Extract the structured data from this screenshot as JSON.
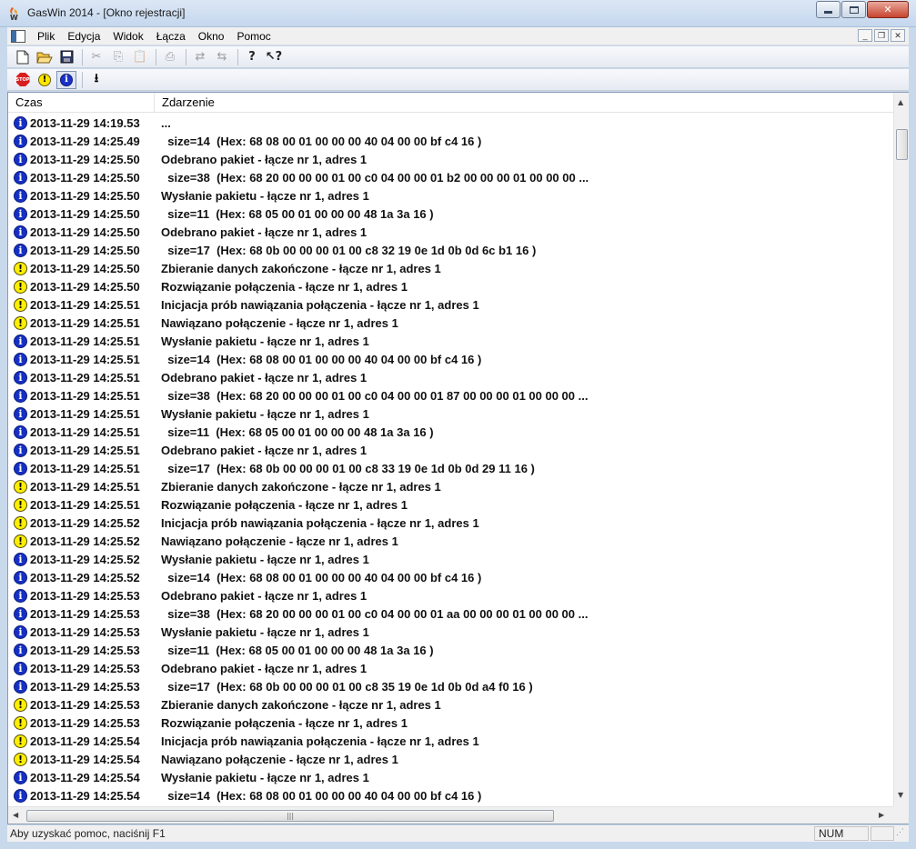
{
  "window": {
    "title": "GasWin 2014 - [Okno rejestracji]",
    "minimize": "0",
    "maximize": "1",
    "close": "r"
  },
  "menu": [
    {
      "label": "Plik"
    },
    {
      "label": "Edycja"
    },
    {
      "label": "Widok"
    },
    {
      "label": "Łącza"
    },
    {
      "label": "Okno"
    },
    {
      "label": "Pomoc"
    }
  ],
  "toolbar1": [
    "new-file-icon",
    "open-folder-icon",
    "save-icon",
    "cut-icon",
    "copy-icon",
    "paste-icon",
    "print-icon",
    "connect-icon",
    "disconnect-icon",
    "help-icon",
    "context-help-icon"
  ],
  "toolbar2": [
    "stop-icon",
    "warning-filter-icon",
    "info-filter-icon",
    "download-icon"
  ],
  "columns": {
    "time": "Czas",
    "event": "Zdarzenie"
  },
  "colors": {
    "info": "#1530c4",
    "warning": "#ffee00"
  },
  "log": [
    {
      "type": "info",
      "time": "2013-11-29 14:19.53",
      "event": "..."
    },
    {
      "type": "info",
      "time": "2013-11-29 14:25.49",
      "event": "  size=14  (Hex: 68 08 00 01 00 00 00 40 04 00 00 bf c4 16 )"
    },
    {
      "type": "info",
      "time": "2013-11-29 14:25.50",
      "event": "Odebrano pakiet - łącze nr 1, adres 1"
    },
    {
      "type": "info",
      "time": "2013-11-29 14:25.50",
      "event": "  size=38  (Hex: 68 20 00 00 00 01 00 c0 04 00 00 01 b2 00 00 00 01 00 00 00 ..."
    },
    {
      "type": "info",
      "time": "2013-11-29 14:25.50",
      "event": "Wysłanie pakietu - łącze nr 1, adres 1"
    },
    {
      "type": "info",
      "time": "2013-11-29 14:25.50",
      "event": "  size=11  (Hex: 68 05 00 01 00 00 00 48 1a 3a 16 )"
    },
    {
      "type": "info",
      "time": "2013-11-29 14:25.50",
      "event": "Odebrano pakiet - łącze nr 1, adres 1"
    },
    {
      "type": "info",
      "time": "2013-11-29 14:25.50",
      "event": "  size=17  (Hex: 68 0b 00 00 00 01 00 c8 32 19 0e 1d 0b 0d 6c b1 16 )"
    },
    {
      "type": "warn",
      "time": "2013-11-29 14:25.50",
      "event": "Zbieranie danych zakończone - łącze nr 1, adres 1"
    },
    {
      "type": "warn",
      "time": "2013-11-29 14:25.50",
      "event": "Rozwiązanie połączenia - łącze nr 1, adres 1"
    },
    {
      "type": "warn",
      "time": "2013-11-29 14:25.51",
      "event": "Inicjacja prób nawiązania połączenia - łącze nr 1, adres 1"
    },
    {
      "type": "warn",
      "time": "2013-11-29 14:25.51",
      "event": "Nawiązano połączenie - łącze nr 1, adres 1"
    },
    {
      "type": "info",
      "time": "2013-11-29 14:25.51",
      "event": "Wysłanie pakietu - łącze nr 1, adres 1"
    },
    {
      "type": "info",
      "time": "2013-11-29 14:25.51",
      "event": "  size=14  (Hex: 68 08 00 01 00 00 00 40 04 00 00 bf c4 16 )"
    },
    {
      "type": "info",
      "time": "2013-11-29 14:25.51",
      "event": "Odebrano pakiet - łącze nr 1, adres 1"
    },
    {
      "type": "info",
      "time": "2013-11-29 14:25.51",
      "event": "  size=38  (Hex: 68 20 00 00 00 01 00 c0 04 00 00 01 87 00 00 00 01 00 00 00 ..."
    },
    {
      "type": "info",
      "time": "2013-11-29 14:25.51",
      "event": "Wysłanie pakietu - łącze nr 1, adres 1"
    },
    {
      "type": "info",
      "time": "2013-11-29 14:25.51",
      "event": "  size=11  (Hex: 68 05 00 01 00 00 00 48 1a 3a 16 )"
    },
    {
      "type": "info",
      "time": "2013-11-29 14:25.51",
      "event": "Odebrano pakiet - łącze nr 1, adres 1"
    },
    {
      "type": "info",
      "time": "2013-11-29 14:25.51",
      "event": "  size=17  (Hex: 68 0b 00 00 00 01 00 c8 33 19 0e 1d 0b 0d 29 11 16 )"
    },
    {
      "type": "warn",
      "time": "2013-11-29 14:25.51",
      "event": "Zbieranie danych zakończone - łącze nr 1, adres 1"
    },
    {
      "type": "warn",
      "time": "2013-11-29 14:25.51",
      "event": "Rozwiązanie połączenia - łącze nr 1, adres 1"
    },
    {
      "type": "warn",
      "time": "2013-11-29 14:25.52",
      "event": "Inicjacja prób nawiązania połączenia - łącze nr 1, adres 1"
    },
    {
      "type": "warn",
      "time": "2013-11-29 14:25.52",
      "event": "Nawiązano połączenie - łącze nr 1, adres 1"
    },
    {
      "type": "info",
      "time": "2013-11-29 14:25.52",
      "event": "Wysłanie pakietu - łącze nr 1, adres 1"
    },
    {
      "type": "info",
      "time": "2013-11-29 14:25.52",
      "event": "  size=14  (Hex: 68 08 00 01 00 00 00 40 04 00 00 bf c4 16 )"
    },
    {
      "type": "info",
      "time": "2013-11-29 14:25.53",
      "event": "Odebrano pakiet - łącze nr 1, adres 1"
    },
    {
      "type": "info",
      "time": "2013-11-29 14:25.53",
      "event": "  size=38  (Hex: 68 20 00 00 00 01 00 c0 04 00 00 01 aa 00 00 00 01 00 00 00 ..."
    },
    {
      "type": "info",
      "time": "2013-11-29 14:25.53",
      "event": "Wysłanie pakietu - łącze nr 1, adres 1"
    },
    {
      "type": "info",
      "time": "2013-11-29 14:25.53",
      "event": "  size=11  (Hex: 68 05 00 01 00 00 00 48 1a 3a 16 )"
    },
    {
      "type": "info",
      "time": "2013-11-29 14:25.53",
      "event": "Odebrano pakiet - łącze nr 1, adres 1"
    },
    {
      "type": "info",
      "time": "2013-11-29 14:25.53",
      "event": "  size=17  (Hex: 68 0b 00 00 00 01 00 c8 35 19 0e 1d 0b 0d a4 f0 16 )"
    },
    {
      "type": "warn",
      "time": "2013-11-29 14:25.53",
      "event": "Zbieranie danych zakończone - łącze nr 1, adres 1"
    },
    {
      "type": "warn",
      "time": "2013-11-29 14:25.53",
      "event": "Rozwiązanie połączenia - łącze nr 1, adres 1"
    },
    {
      "type": "warn",
      "time": "2013-11-29 14:25.54",
      "event": "Inicjacja prób nawiązania połączenia - łącze nr 1, adres 1"
    },
    {
      "type": "warn",
      "time": "2013-11-29 14:25.54",
      "event": "Nawiązano połączenie - łącze nr 1, adres 1"
    },
    {
      "type": "info",
      "time": "2013-11-29 14:25.54",
      "event": "Wysłanie pakietu - łącze nr 1, adres 1"
    },
    {
      "type": "info",
      "time": "2013-11-29 14:25.54",
      "event": "  size=14  (Hex: 68 08 00 01 00 00 00 40 04 00 00 bf c4 16 )"
    }
  ],
  "status": {
    "help_text": "Aby uzyskać pomoc, naciśnij F1",
    "num": "NUM"
  }
}
